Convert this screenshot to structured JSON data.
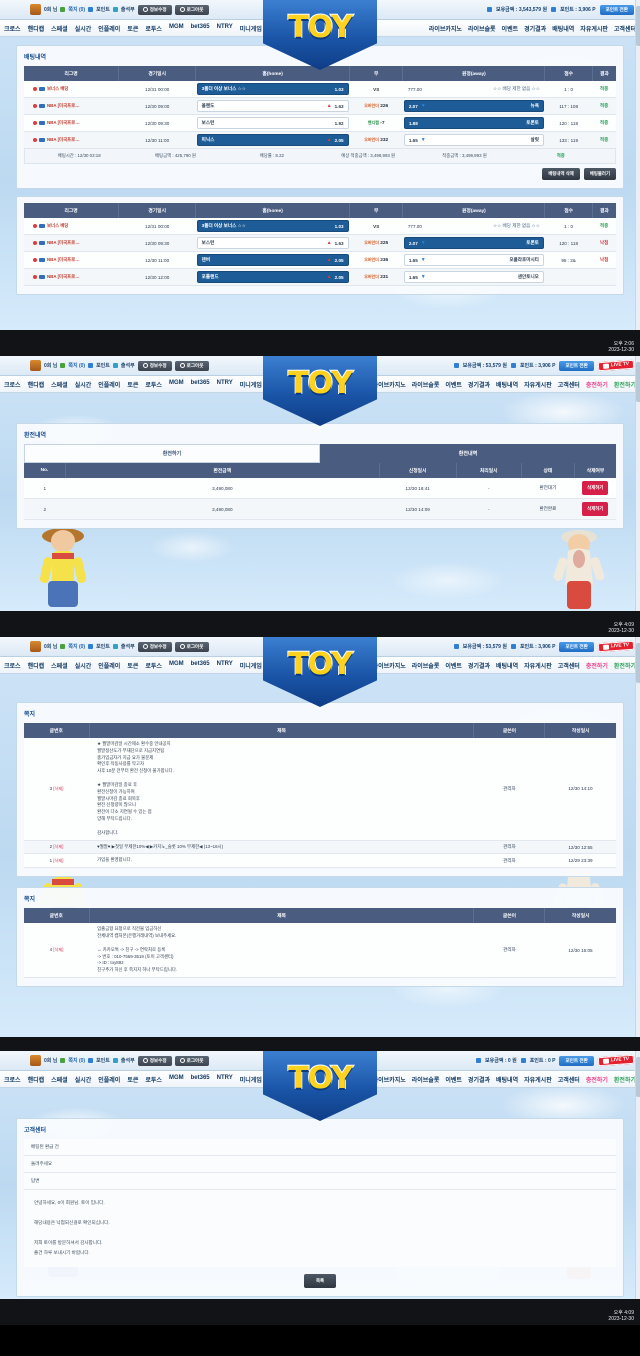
{
  "site": {
    "logo_text": "TOY"
  },
  "topbar": {
    "greeting": "0회 님",
    "message_label": "쪽지 (0)",
    "point_label": "포인트",
    "attendance_label": "출석부",
    "info_button": "정보수정",
    "logout_button": "로그아웃",
    "balance_label": "보유금액 :",
    "point_amount_label": "포인트 :",
    "point_transfer_button": "포인트 전환",
    "live_tv": "LIVE TV"
  },
  "nav": {
    "left": [
      "크로스",
      "핸디캡",
      "스페셜",
      "실시간",
      "인플레이",
      "토큰",
      "로투스",
      "MGM",
      "bet365",
      "NTRY",
      "미니게임"
    ],
    "right": [
      "라이브카지노",
      "라이브슬롯",
      "이벤트",
      "경기결과",
      "배팅내역",
      "자유게시판",
      "고객센터"
    ],
    "charge": "충전하기",
    "exchange": "환전하기"
  },
  "panel1": {
    "balance": "3,543,579 원",
    "points": "3,906 P",
    "card_title": "배팅내역",
    "columns": [
      "리그명",
      "경기일시",
      "홈(home)",
      "무",
      "원정(away)",
      "점수",
      "결과"
    ],
    "tables": [
      {
        "rows": [
          {
            "league": "보너스 배당",
            "time": "12/31 00:00",
            "home": "3폴더 이상 보너스 ☆☆",
            "home_odds": "1.03",
            "home_sel": true,
            "home_arrow": "",
            "draw_tag": "",
            "draw": "VS",
            "away_odds": "777.00",
            "away": "☆☆ 배당 제한 없음 ☆☆",
            "away_sel": false,
            "away_arrow": "",
            "score": "1 : 0",
            "result": "적중",
            "result_type": "win"
          },
          {
            "league": "NBA [미국프로…",
            "time": "12/30 09:00",
            "home": "올랜도",
            "home_odds": "1.63",
            "home_sel": false,
            "home_arrow": "up",
            "draw_tag": "오버언더",
            "draw": "226",
            "away_odds": "2.07",
            "away": "뉴욕",
            "away_sel": true,
            "away_arrow": "dn",
            "score": "117 : 108",
            "result": "적중",
            "result_type": "win"
          },
          {
            "league": "NBA [미국프로…",
            "time": "12/30 09:30",
            "home": "보스턴",
            "home_odds": "1.92",
            "home_sel": false,
            "home_arrow": "",
            "draw_tag": "핸디캡",
            "draw": "-7",
            "away_odds": "1.88",
            "away": "토론토",
            "away_sel": true,
            "away_arrow": "",
            "score": "120 : 118",
            "result": "적중",
            "result_type": "win"
          },
          {
            "league": "NBA [미국프로…",
            "time": "12/30 11:00",
            "home": "피닉스",
            "home_odds": "2.05",
            "home_sel": true,
            "home_arrow": "up",
            "draw_tag": "오버언더",
            "draw": "232",
            "away_odds": "1.65",
            "away": "살럿",
            "away_sel": false,
            "away_arrow": "dn",
            "score": "133 : 119",
            "result": "적중",
            "result_type": "win"
          }
        ],
        "summary": [
          "배팅시간 : 12/30 03:18",
          "배팅금액 : 425,790 원",
          "배당률 : 8.22",
          "예상 적중금액 : 3,499,993 원",
          "적중금액 : 3,499,993 원",
          "적중"
        ]
      },
      {
        "rows": [
          {
            "league": "보너스 배당",
            "time": "12/31 00:00",
            "home": "3폴더 이상 보너스 ☆☆",
            "home_odds": "1.03",
            "home_sel": true,
            "home_arrow": "",
            "draw_tag": "",
            "draw": "VS",
            "away_odds": "777.00",
            "away": "☆☆ 배당 제한 없음 ☆☆",
            "away_sel": false,
            "away_arrow": "",
            "score": "1 : 0",
            "result": "적중",
            "result_type": "win"
          },
          {
            "league": "NBA [미국프로…",
            "time": "12/30 09:30",
            "home": "보스턴",
            "home_odds": "1.63",
            "home_sel": false,
            "home_arrow": "up",
            "draw_tag": "오버언더",
            "draw": "225",
            "away_odds": "2.07",
            "away": "토론토",
            "away_sel": true,
            "away_arrow": "dn",
            "score": "120 : 118",
            "result": "낙첨",
            "result_type": "lose"
          },
          {
            "league": "NBA [미국프로…",
            "time": "12/30 11:00",
            "home": "덴버",
            "home_odds": "2.05",
            "home_sel": true,
            "home_arrow": "up",
            "draw_tag": "오버언더",
            "draw": "236",
            "away_odds": "1.65",
            "away": "오클라호마시티",
            "away_sel": false,
            "away_arrow": "dn",
            "score": "95 : 2&",
            "result": "낙첨",
            "result_type": "lose"
          },
          {
            "league": "NBA [미국프로…",
            "time": "12/30 12:00",
            "home": "포틀랜드",
            "home_odds": "2.05",
            "home_sel": true,
            "home_arrow": "up",
            "draw_tag": "오버언더",
            "draw": "231",
            "away_odds": "1.65",
            "away": "샌안토니오",
            "away_sel": false,
            "away_arrow": "dn",
            "score": "",
            "result": "",
            "result_type": ""
          }
        ],
        "summary": []
      }
    ],
    "delete_button": "배팅내역 삭제",
    "refresh_button": "배팅물러기",
    "clock_time": "오후 2:06",
    "clock_date": "2023-12-30"
  },
  "panel2": {
    "balance": "53,579 원",
    "points": "3,906 P",
    "card_title": "환전내역",
    "tabs": [
      "환전하기",
      "환전내역"
    ],
    "active_tab": 1,
    "columns": [
      "No.",
      "환전금액",
      "신청일시",
      "처리일시",
      "상태",
      "삭제여부"
    ],
    "rows": [
      {
        "no": "1",
        "amount": "3,490,080",
        "req": "12/30 16:41",
        "proc": "-",
        "status": "환전대기",
        "delete": "삭제하기"
      },
      {
        "no": "2",
        "amount": "3,490,080",
        "req": "12/30 14:09",
        "proc": "-",
        "status": "환전완료",
        "delete": "삭제하기"
      }
    ],
    "clock_time": "오후 4:09",
    "clock_date": "2023-12-30"
  },
  "panel3": {
    "balance": "53,579 원",
    "points": "3,906 P",
    "card_title": "쪽지",
    "columns": [
      "글번호",
      "제목",
      "글쓴이",
      "작성일시"
    ],
    "rows": [
      {
        "no": "3",
        "del": "[삭제]",
        "lines": [
          "★ 월말마감일 시간제소 환수중 안내공지",
          "월말정산도가 부재단으로 지급지연됨",
          "충가입금자가 지급 요가 불문제",
          "확인후 작동사용를 막고자",
          "사후 10분 전부터 환전 신청이 불가합니다.",
          "",
          "★ 월말마감일 종료 후",
          "환전신청이 가능하며",
          "월말시마감 종료 회복후",
          "환전 신청량이 많으니",
          "환전이 다소 지연될 수 있는 점",
          "양해 부탁드립니다.",
          "",
          "감사합니다."
        ],
        "author": "관리자",
        "date": "12/30 14:10"
      },
      {
        "no": "2",
        "del": "[삭제]",
        "lines": [
          "♥월말♥ ▶첫일 무제한10%◀ ▶카지노_슬롯 10% 무제한◀ (13~16시)"
        ],
        "author": "관리자",
        "date": "12/30 12:55"
      },
      {
        "no": "1",
        "del": "[삭제]",
        "lines": [
          "가입을 환영합니다."
        ],
        "author": "관리자",
        "date": "12/29 23:39"
      }
    ],
    "card2_title": "쪽지",
    "rows2": [
      {
        "no": "4",
        "del": "[삭제]",
        "lines": [
          "입출금형 요청으로 직전불 입금하신",
          "전체내역 캡처본(은행거래내역) 보내주세요.",
          "",
          "↔ 카카오톡 -> 친구 -> 연락처로 등록",
          "-> 번호 : 010-7569-3519 (토이 고객센터)",
          "-> ID : toy892",
          "친구추가 하신 후 쪽지지 하나 부탁드립니다."
        ],
        "author": "관리자",
        "date": "12/30 16:05"
      }
    ],
    "clock_time": "오후 4:09",
    "clock_date": "2023-12-30"
  },
  "panel4": {
    "balance": "0 원",
    "points": "0 P",
    "card_title": "고객센터",
    "subject": "배팅된 환급 건",
    "field2": "돌려주세요",
    "field3": "답변",
    "body_lines": [
      "안녕하세요, 0이 회원님. 토이 입니다.",
      "",
      "해당내용은 낙첨되신걸로 확인되십니다.",
      "",
      "저희 토이를 방문하셔서 감사합니다.",
      "즐건 하루 보내시기 바랍니다."
    ],
    "list_button": "목록",
    "clock_time": "오후 4:09",
    "clock_date": "2023-12-30"
  }
}
